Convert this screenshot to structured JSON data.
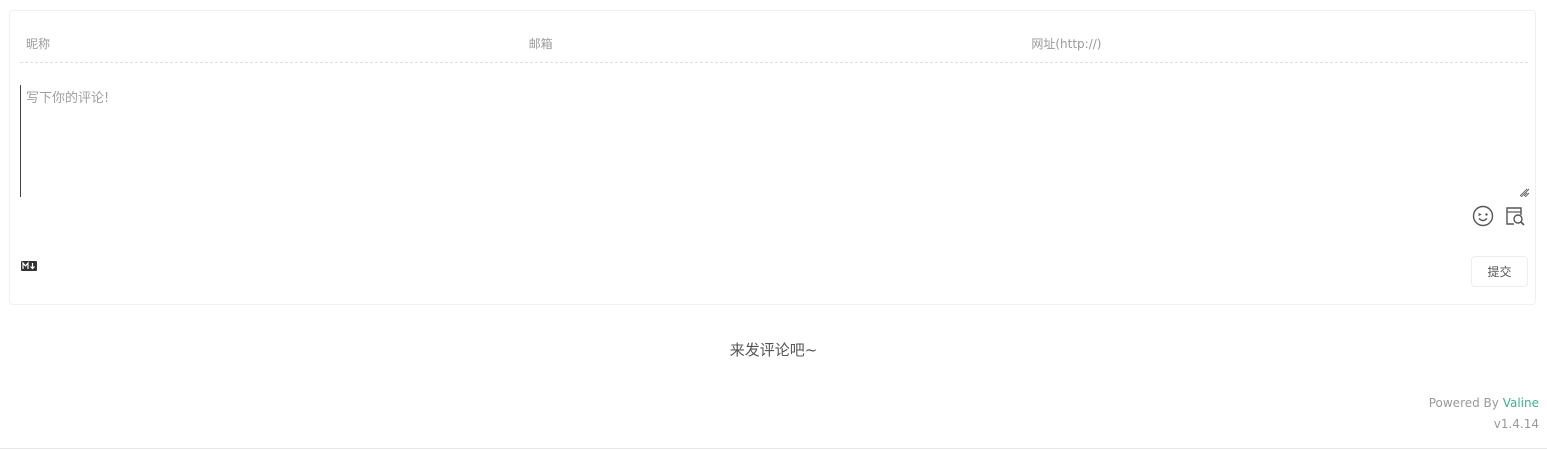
{
  "form": {
    "nick_placeholder": "昵称",
    "mail_placeholder": "邮箱",
    "link_placeholder": "网址(http://)",
    "comment_placeholder": "写下你的评论!",
    "submit_label": "提交"
  },
  "icons": {
    "emoji": "emoji-icon",
    "preview": "preview-icon",
    "markdown": "markdown-icon"
  },
  "empty_message": "来发评论吧~",
  "footer": {
    "powered_prefix": "Powered By ",
    "brand": "Valine",
    "version": "v1.4.14"
  },
  "colors": {
    "accent": "#3cb18f",
    "text": "#555555",
    "muted": "#999999",
    "border": "#f0f0f0"
  }
}
